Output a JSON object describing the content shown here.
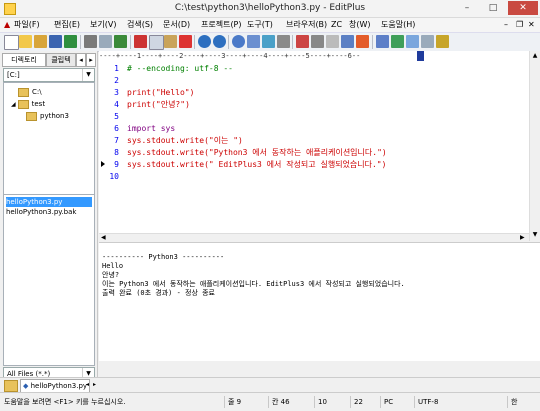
{
  "window": {
    "title": "C:\\test\\python3\\helloPython3.py - EditPlus",
    "controls": {
      "minimize": "–",
      "maximize": "□",
      "close": "✕"
    }
  },
  "menu": [
    {
      "label": "파일(F)"
    },
    {
      "label": "편집(E)"
    },
    {
      "label": "보기(V)"
    },
    {
      "label": "검색(S)"
    },
    {
      "label": "문서(D)"
    },
    {
      "label": "프로젝트(P)"
    },
    {
      "label": "도구(T)"
    },
    {
      "label": "브라우저(B)"
    },
    {
      "label": "ZC"
    },
    {
      "label": "창(W)"
    },
    {
      "label": "도움말(H)"
    }
  ],
  "left_panel": {
    "tabs": [
      "디렉토리",
      "클립텍"
    ],
    "drive": "[C:]",
    "tree": [
      {
        "label": "C:\\",
        "indent": 0
      },
      {
        "label": "test",
        "indent": 1
      },
      {
        "label": "python3",
        "indent": 2
      }
    ],
    "files": [
      {
        "name": "helloPython3.py",
        "selected": true
      },
      {
        "name": "helloPython3.py.bak",
        "selected": false
      }
    ],
    "filter": "All Files (*.*)"
  },
  "ruler": "----+----1----+----2----+----3----+----4----+----5----+----6--",
  "editor": {
    "lines": [
      {
        "num": "1",
        "text": "# --encoding: utf-8 --",
        "type": "comment"
      },
      {
        "num": "2",
        "text": "",
        "type": "blank"
      },
      {
        "num": "3",
        "text": "print(\"Hello\")",
        "type": "print"
      },
      {
        "num": "4",
        "text": "print(\"안녕?\")",
        "type": "print"
      },
      {
        "num": "5",
        "text": "",
        "type": "blank"
      },
      {
        "num": "6",
        "text": "import sys",
        "type": "import"
      },
      {
        "num": "7",
        "text": "sys.stdout.write(\"이는 \")",
        "type": "write"
      },
      {
        "num": "8",
        "text": "sys.stdout.write(\"Python3 에서 동작하는 애플리케이션입니다.\")",
        "type": "write"
      },
      {
        "num": "9",
        "text": "sys.stdout.write(\" EditPlus3 에서 작성되고 실행되었습니다.\")",
        "type": "write"
      },
      {
        "num": "10",
        "text": "",
        "type": "blank"
      }
    ]
  },
  "output": {
    "lines": [
      "---------- Python3 ----------",
      "Hello",
      "안녕?",
      "이는 Python3 에서 동작하는 애플리케이션입니다. EditPlus3 에서 작성되고 실행되었습니다.",
      "출력 완료 (0초 경과) - 정상 종료"
    ]
  },
  "doc_tab": "helloPython3.py",
  "status": {
    "help": "도움말을 보려면 <F1> 키를 누르십시오.",
    "line": "줄 9",
    "col": "칸 46",
    "pos1": "10",
    "pos2": "22",
    "mode": "PC",
    "encoding": "UTF-8",
    "lang": "한"
  },
  "colors": {
    "line_number": "#0000ee",
    "string": "#cc0000",
    "comment": "#008000",
    "selection": "#3399ff",
    "close_button": "#c94a41"
  }
}
